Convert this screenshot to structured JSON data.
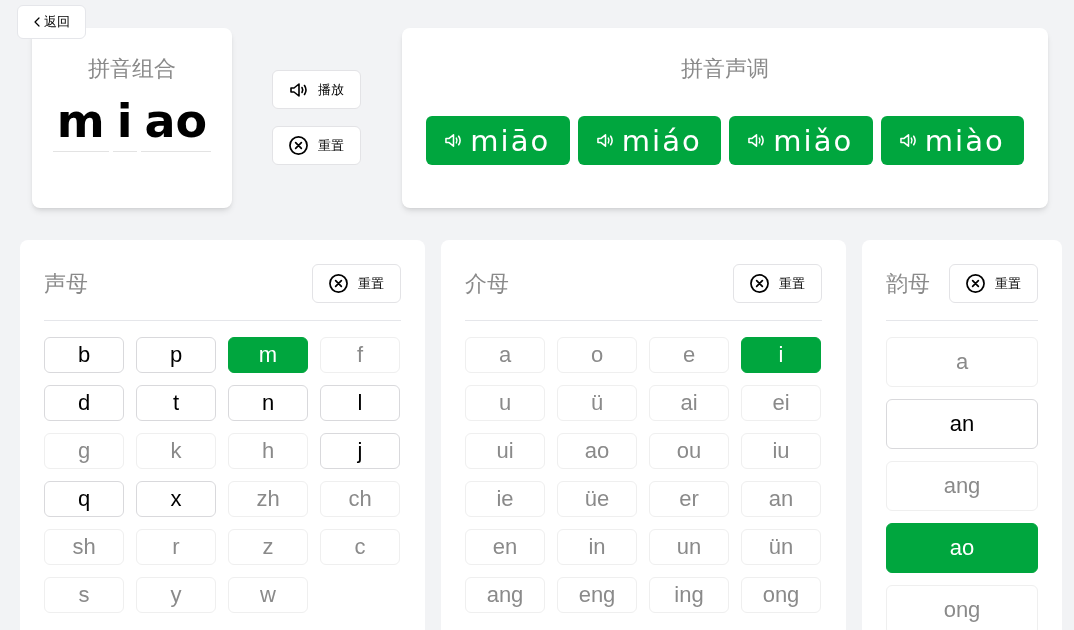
{
  "back_button": {
    "label": "返回"
  },
  "combination": {
    "title": "拼音组合",
    "segments": [
      "m",
      "i",
      "ao"
    ]
  },
  "actions": [
    {
      "kind": "play",
      "label": "播放"
    },
    {
      "kind": "reset",
      "label": "重置"
    }
  ],
  "tones": {
    "title": "拼音声调",
    "buttons": [
      "miāo",
      "miáo",
      "miǎo",
      "miào"
    ]
  },
  "panels": [
    {
      "kind": "grid",
      "title": "声母",
      "reset_label": "重置",
      "items": [
        {
          "label": "b",
          "selected": false,
          "disabled": false
        },
        {
          "label": "p",
          "selected": false,
          "disabled": false
        },
        {
          "label": "m",
          "selected": true,
          "disabled": false
        },
        {
          "label": "f",
          "selected": false,
          "disabled": true
        },
        {
          "label": "d",
          "selected": false,
          "disabled": false
        },
        {
          "label": "t",
          "selected": false,
          "disabled": false
        },
        {
          "label": "n",
          "selected": false,
          "disabled": false
        },
        {
          "label": "l",
          "selected": false,
          "disabled": false
        },
        {
          "label": "g",
          "selected": false,
          "disabled": true
        },
        {
          "label": "k",
          "selected": false,
          "disabled": true
        },
        {
          "label": "h",
          "selected": false,
          "disabled": true
        },
        {
          "label": "j",
          "selected": false,
          "disabled": false
        },
        {
          "label": "q",
          "selected": false,
          "disabled": false
        },
        {
          "label": "x",
          "selected": false,
          "disabled": false
        },
        {
          "label": "zh",
          "selected": false,
          "disabled": true
        },
        {
          "label": "ch",
          "selected": false,
          "disabled": true
        },
        {
          "label": "sh",
          "selected": false,
          "disabled": true
        },
        {
          "label": "r",
          "selected": false,
          "disabled": true
        },
        {
          "label": "z",
          "selected": false,
          "disabled": true
        },
        {
          "label": "c",
          "selected": false,
          "disabled": true
        },
        {
          "label": "s",
          "selected": false,
          "disabled": true
        },
        {
          "label": "y",
          "selected": false,
          "disabled": true
        },
        {
          "label": "w",
          "selected": false,
          "disabled": true
        }
      ]
    },
    {
      "kind": "grid",
      "title": "介母",
      "reset_label": "重置",
      "items": [
        {
          "label": "a",
          "selected": false,
          "disabled": true
        },
        {
          "label": "o",
          "selected": false,
          "disabled": true
        },
        {
          "label": "e",
          "selected": false,
          "disabled": true
        },
        {
          "label": "i",
          "selected": true,
          "disabled": false
        },
        {
          "label": "u",
          "selected": false,
          "disabled": true
        },
        {
          "label": "ü",
          "selected": false,
          "disabled": true
        },
        {
          "label": "ai",
          "selected": false,
          "disabled": true
        },
        {
          "label": "ei",
          "selected": false,
          "disabled": true
        },
        {
          "label": "ui",
          "selected": false,
          "disabled": true
        },
        {
          "label": "ao",
          "selected": false,
          "disabled": true
        },
        {
          "label": "ou",
          "selected": false,
          "disabled": true
        },
        {
          "label": "iu",
          "selected": false,
          "disabled": true
        },
        {
          "label": "ie",
          "selected": false,
          "disabled": true
        },
        {
          "label": "üe",
          "selected": false,
          "disabled": true
        },
        {
          "label": "er",
          "selected": false,
          "disabled": true
        },
        {
          "label": "an",
          "selected": false,
          "disabled": true
        },
        {
          "label": "en",
          "selected": false,
          "disabled": true
        },
        {
          "label": "in",
          "selected": false,
          "disabled": true
        },
        {
          "label": "un",
          "selected": false,
          "disabled": true
        },
        {
          "label": "ün",
          "selected": false,
          "disabled": true
        },
        {
          "label": "ang",
          "selected": false,
          "disabled": true
        },
        {
          "label": "eng",
          "selected": false,
          "disabled": true
        },
        {
          "label": "ing",
          "selected": false,
          "disabled": true
        },
        {
          "label": "ong",
          "selected": false,
          "disabled": true
        }
      ]
    },
    {
      "kind": "list",
      "title": "韵母",
      "reset_label": "重置",
      "items": [
        {
          "label": "a",
          "selected": false,
          "disabled": true
        },
        {
          "label": "an",
          "selected": false,
          "disabled": false
        },
        {
          "label": "ang",
          "selected": false,
          "disabled": true
        },
        {
          "label": "ao",
          "selected": true,
          "disabled": false
        },
        {
          "label": "ong",
          "selected": false,
          "disabled": true
        }
      ]
    }
  ]
}
